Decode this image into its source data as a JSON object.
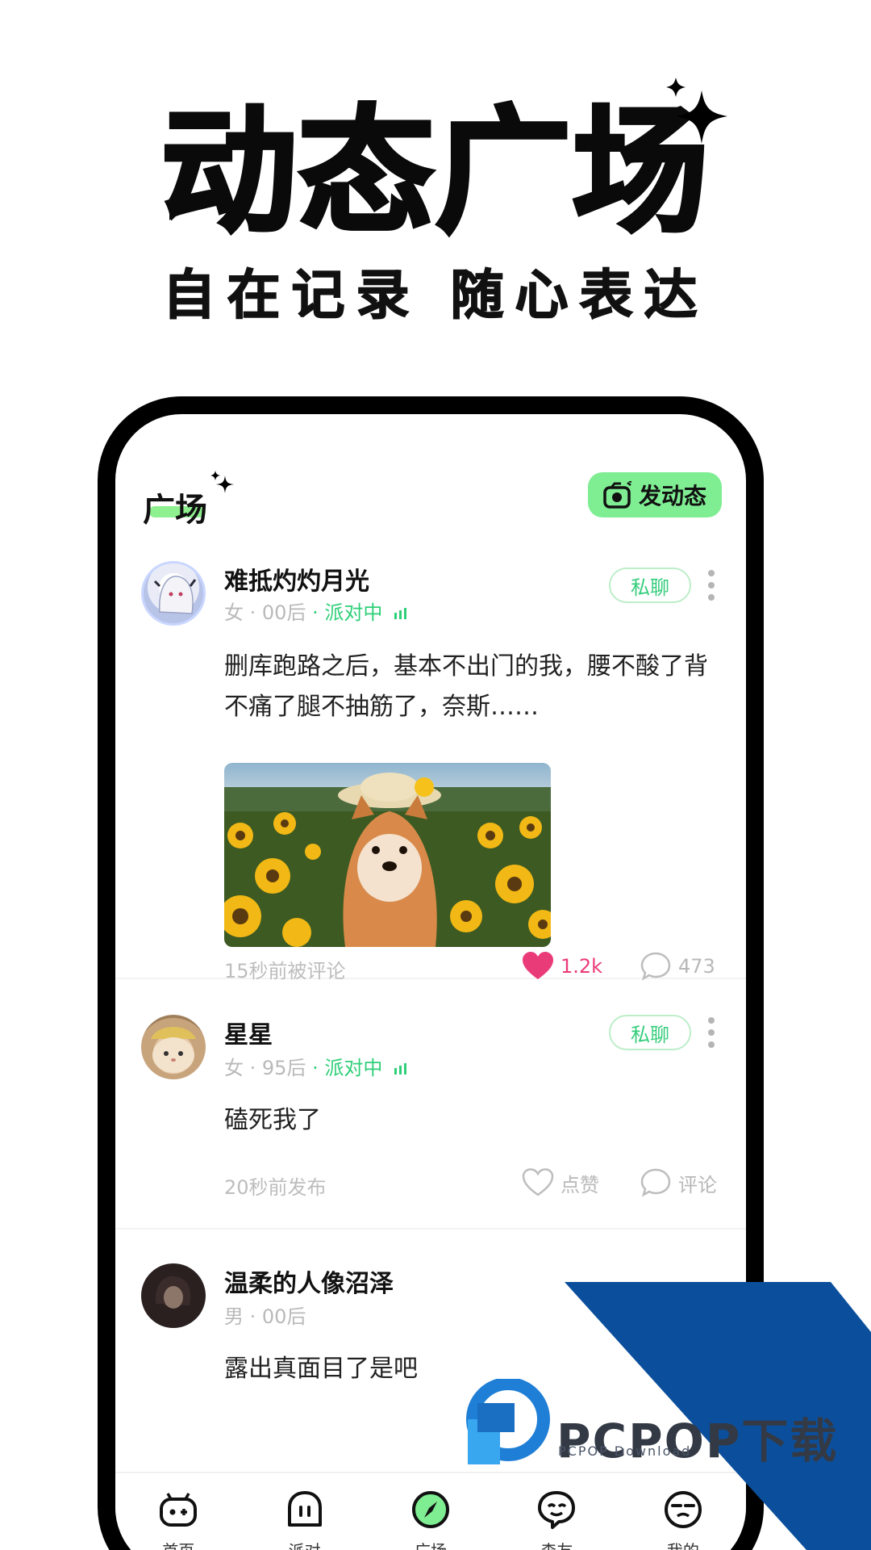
{
  "hero": {
    "title": "动态广场",
    "subtitle": "自在记录  随心表达"
  },
  "header": {
    "title": "广场",
    "post_button_label": "发动态"
  },
  "posts": [
    {
      "username": "难抵灼灼月光",
      "gender": "女",
      "age_group": "00后",
      "status": "派对中",
      "chat_label": "私聊",
      "content": "删库跑路之后，基本不出门的我，腰不酸了背不痛了腿不抽筋了，奈斯……",
      "has_photo": true,
      "time": "15秒前被评论",
      "likes": "1.2k",
      "comments": "473"
    },
    {
      "username": "星星",
      "gender": "女",
      "age_group": "95后",
      "status": "派对中",
      "chat_label": "私聊",
      "content": "磕死我了",
      "time": "20秒前发布",
      "likes": "点赞",
      "comments": "评论"
    },
    {
      "username": "温柔的人像沼泽",
      "gender": "男",
      "age_group": "00后",
      "content": "露出真面目了是吧"
    }
  ],
  "tabs": [
    {
      "label": "首页",
      "icon": "gamepad-icon"
    },
    {
      "label": "派对",
      "icon": "party-icon"
    },
    {
      "label": "广场",
      "icon": "plaza-compass-icon",
      "active": true
    },
    {
      "label": "森友",
      "icon": "friends-icon"
    },
    {
      "label": "我的",
      "icon": "profile-icon"
    }
  ],
  "watermark": {
    "brand": "PCPOP下载",
    "sub": "PCPOP Download"
  },
  "colors": {
    "accent_green": "#7fee93",
    "party_green": "#2fcf78",
    "like_pink": "#ea3b79",
    "watermark_blue": "#0b4f9c"
  }
}
